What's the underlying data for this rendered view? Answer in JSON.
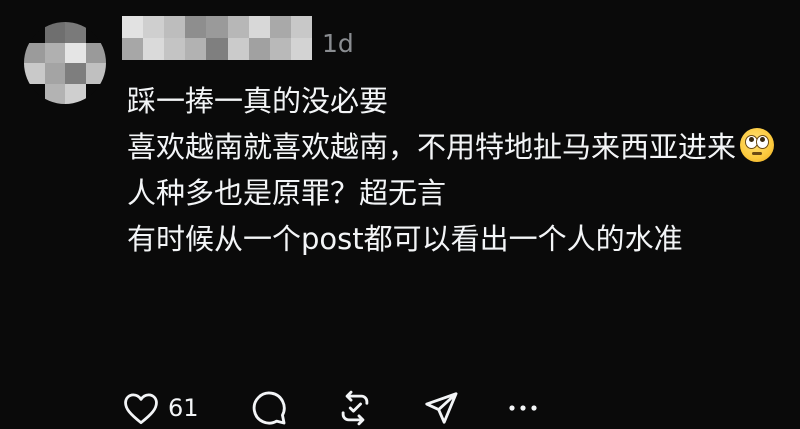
{
  "post": {
    "timestamp": "1d",
    "lines": [
      "踩一捧一真的没必要",
      "喜欢越南就喜欢越南，不用特地扯马来西亚进来",
      "人种多也是原罪？超无言",
      "有时候从一个post都可以看出一个人的水准"
    ],
    "emoji_name": "face-with-rolling-eyes"
  },
  "actions": {
    "like_count": "61",
    "icons": [
      "heart-icon",
      "comment-icon",
      "repost-icon",
      "share-icon",
      "more-icon"
    ]
  },
  "colors": {
    "background": "#0a0a0a",
    "text": "#f3f5f7",
    "secondary": "#8a8d91",
    "icon": "#f3f5f7"
  }
}
